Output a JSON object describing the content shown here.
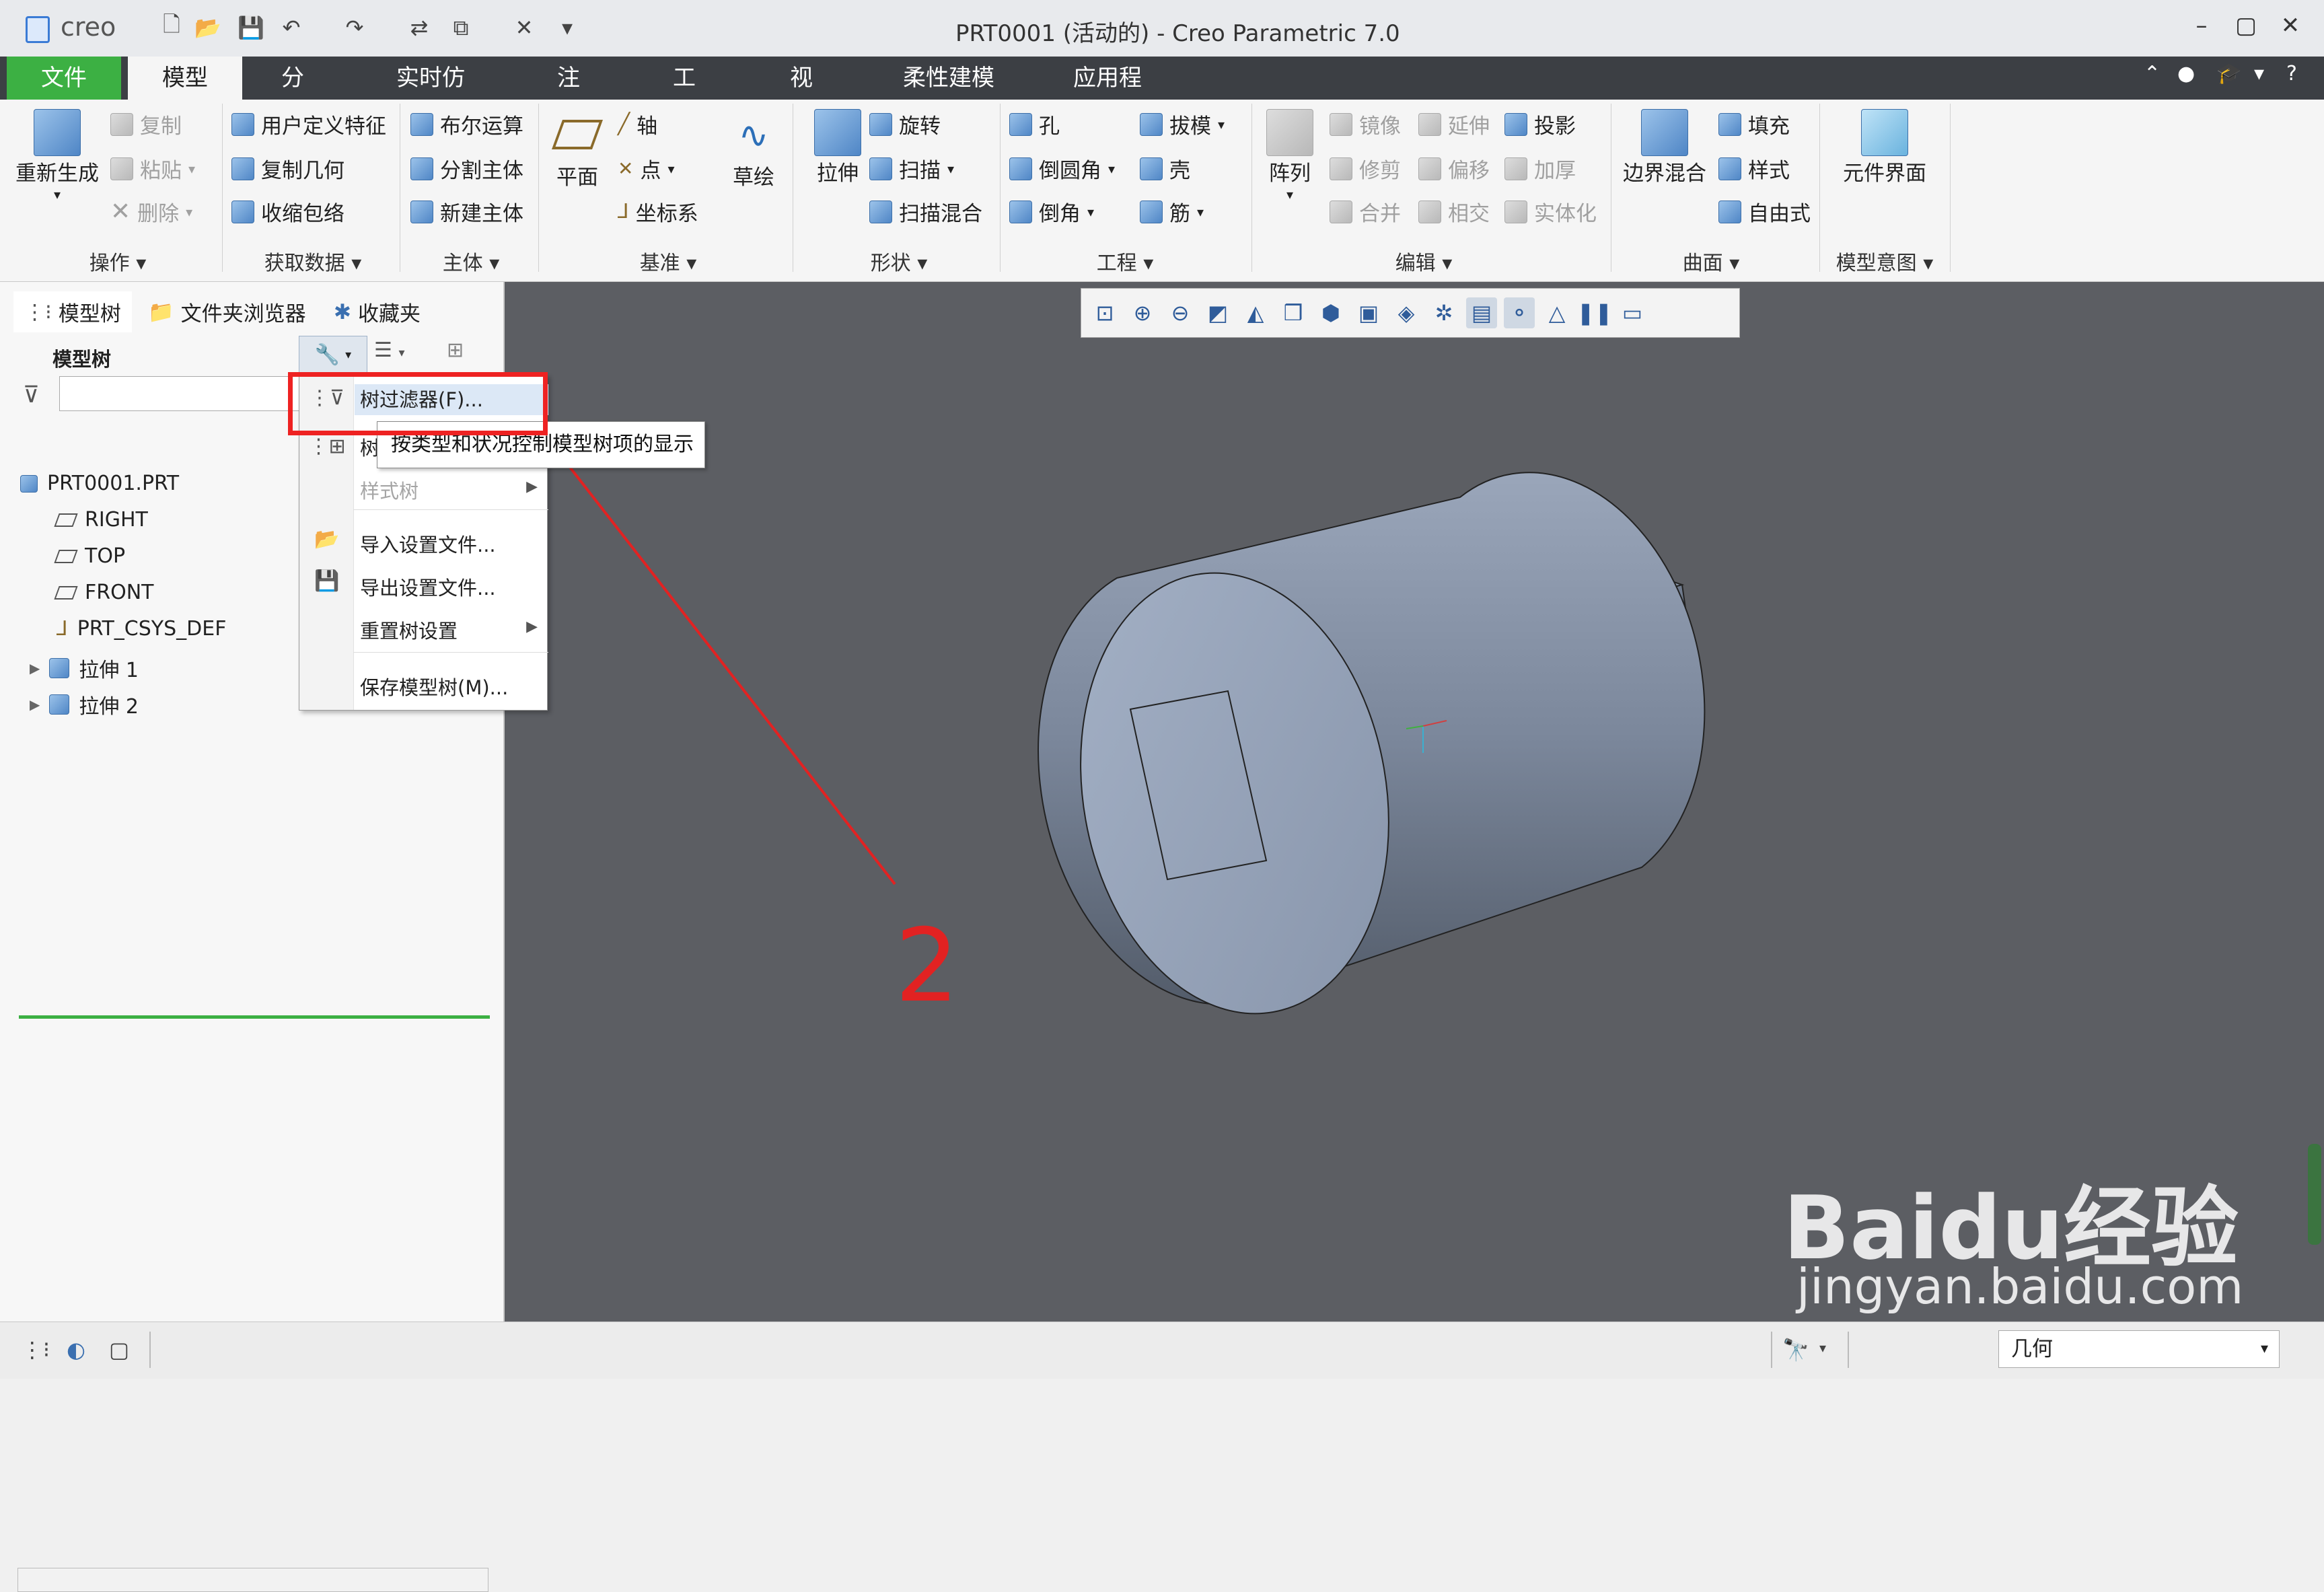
{
  "titlebar": {
    "logo": "creo",
    "window_title": "PRT0001 (活动的) - Creo Parametric 7.0",
    "quick_access_icons": [
      "new-icon",
      "open-icon",
      "save-icon",
      "undo-icon",
      "redo-icon",
      "regenerate-icon",
      "windows-icon",
      "close-window-icon",
      "customize-icon"
    ],
    "window_controls": [
      "minimize",
      "maximize",
      "close"
    ]
  },
  "tabs": {
    "file": "文件",
    "items": [
      "模型",
      "分析",
      "实时仿真",
      "注释",
      "工具",
      "视图",
      "柔性建模",
      "应用程序"
    ],
    "active": "模型"
  },
  "ribbon": {
    "operations": {
      "regenerate": "重新生成",
      "copy": "复制",
      "paste": "粘贴",
      "delete": "删除",
      "label": "操作"
    },
    "get_data": {
      "udf": "用户定义特征",
      "copy_geometry": "复制几何",
      "shrinkwrap": "收缩包络",
      "label": "获取数据"
    },
    "body": {
      "boolean": "布尔运算",
      "split_body": "分割主体",
      "new_body": "新建主体",
      "label": "主体"
    },
    "datum": {
      "plane": "平面",
      "axis": "轴",
      "point": "点",
      "csys": "坐标系",
      "sketch": "草绘",
      "label": "基准"
    },
    "shapes": {
      "extrude": "拉伸",
      "revolve": "旋转",
      "sweep": "扫描",
      "swept_blend": "扫描混合",
      "label": "形状"
    },
    "engineering": {
      "hole": "孔",
      "round": "倒圆角",
      "chamfer": "倒角",
      "draft": "拔模",
      "shell": "壳",
      "rib": "筋",
      "label": "工程"
    },
    "editing": {
      "pattern": "阵列",
      "mirror": "镜像",
      "trim": "修剪",
      "merge": "合并",
      "extend": "延伸",
      "offset": "偏移",
      "intersect": "相交",
      "project": "投影",
      "thicken": "加厚",
      "solidify": "实体化",
      "label": "编辑"
    },
    "surfaces": {
      "boundary_blend": "边界混合",
      "fill": "填充",
      "style": "样式",
      "freestyle": "自由式",
      "label": "曲面"
    },
    "model_intent": {
      "component_interface": "元件界面",
      "label": "模型意图"
    }
  },
  "left_panel": {
    "tabs": [
      "模型树",
      "文件夹浏览器",
      "收藏夹"
    ],
    "tree_title": "模型树",
    "filter_placeholder": "",
    "tree": {
      "root": "PRT0001.PRT",
      "items": [
        "RIGHT",
        "TOP",
        "FRONT",
        "PRT_CSYS_DEF",
        "拉伸 1",
        "拉伸 2"
      ]
    }
  },
  "menu": {
    "items": [
      {
        "label": "树过滤器(F)...",
        "enabled": true
      },
      {
        "label": "树",
        "enabled": true
      },
      {
        "label": "样式树",
        "enabled": false
      },
      {
        "label": "导入设置文件...",
        "enabled": true
      },
      {
        "label": "导出设置文件...",
        "enabled": true
      },
      {
        "label": "重置树设置",
        "enabled": true
      },
      {
        "label": "保存模型树(M)...",
        "enabled": true
      }
    ],
    "tooltip": "按类型和状况控制模型树项的显示"
  },
  "annotation": {
    "step_number": "2",
    "color": "#e22222"
  },
  "view_toolbar_icons": [
    "refit-icon",
    "zoom-in-icon",
    "zoom-out-icon",
    "repaint-icon",
    "display-style-icon",
    "saved-orientations-icon",
    "view-manager-icon",
    "perspective-icon",
    "section-icon",
    "datum-display-icon",
    "annotation-display-icon",
    "spin-center-icon",
    "appearance-icon",
    "pause-icon",
    "hide-icon"
  ],
  "statusbar": {
    "selection_filter": "几何"
  },
  "watermark": {
    "brand": "Baidu经验",
    "url": "jingyan.baidu.com"
  },
  "colors": {
    "file_tab": "#3cb043",
    "tab_bar": "#3c3f44",
    "graphics_bg": "#5c5e63",
    "model": "#8e9aad",
    "highlight": "#e22222"
  }
}
